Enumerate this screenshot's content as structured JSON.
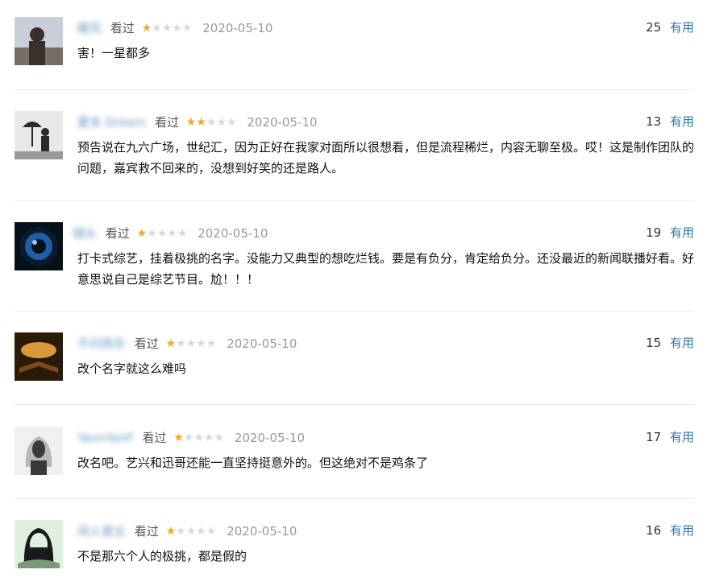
{
  "comments": [
    {
      "username": "暖风",
      "watched": "看过",
      "rating": 1,
      "date": "2020-05-10",
      "votes": "25",
      "useful_label": "有用",
      "content": "害！一星都多",
      "avatar_colors": [
        "#7a6d68",
        "#c9cfd8",
        "#3a2f2d"
      ]
    },
    {
      "username": "夏末 Dream",
      "watched": "看过",
      "rating": 2,
      "date": "2020-05-10",
      "votes": "13",
      "useful_label": "有用",
      "content": "预告说在九六广场，世纪汇，因为正好在我家对面所以很想看，但是流程稀烂，内容无聊至极。哎！这是制作团队的问题，嘉宾救不回来的，没想到好笑的还是路人。",
      "avatar_colors": [
        "#e8e8e8",
        "#2a2a2a",
        "#9a9a9a"
      ]
    },
    {
      "username": "镜头",
      "watched": "看过",
      "rating": 1,
      "date": "2020-05-10",
      "votes": "19",
      "useful_label": "有用",
      "content": "打卡式综艺，挂着极挑的名字。没能力又典型的想吃烂钱。要是有负分，肯定给负分。还没最近的新闻联播好看。好意思说自己是综艺节目。尬！！！",
      "avatar_colors": [
        "#0c1a2e",
        "#1e5fa8",
        "#061018"
      ]
    },
    {
      "username": "不问西东",
      "watched": "看过",
      "rating": 1,
      "date": "2020-05-10",
      "votes": "15",
      "useful_label": "有用",
      "content": "改个名字就这么难吗",
      "avatar_colors": [
        "#2a1a08",
        "#d89a3a",
        "#7a4a18"
      ]
    },
    {
      "username": "YannYanF",
      "watched": "看过",
      "rating": 1,
      "date": "2020-05-10",
      "votes": "17",
      "useful_label": "有用",
      "content": "改名吧。艺兴和迅哥还能一直坚持挺意外的。但这绝对不是鸡条了",
      "avatar_colors": [
        "#f0f0f0",
        "#3a3a3a",
        "#b8b8b8"
      ]
    },
    {
      "username": "闲人君主",
      "watched": "看过",
      "rating": 1,
      "date": "2020-05-10",
      "votes": "16",
      "useful_label": "有用",
      "content": "不是那六个人的极挑，都是假的",
      "avatar_colors": [
        "#dff0e0",
        "#1a1a1a",
        "#7a9a7a"
      ]
    }
  ]
}
